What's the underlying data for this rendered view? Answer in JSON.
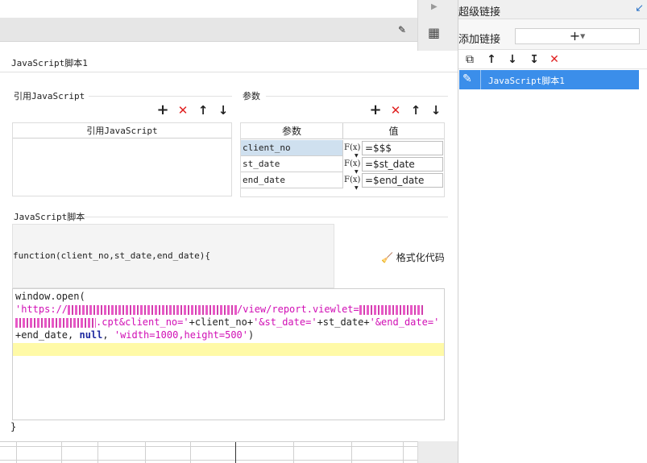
{
  "right_panel": {
    "title": "超级链接",
    "add_label": "添加链接",
    "add_button": "+",
    "icons": [
      "copy-icon",
      "arrow-up-icon",
      "arrow-down-icon",
      "move-bottom-icon",
      "delete-icon"
    ],
    "list": [
      {
        "label": "JavaScript脚本1",
        "selected": true
      }
    ]
  },
  "main": {
    "tab_title": "JavaScript脚本1",
    "ref_section": {
      "title": "引用JavaScript",
      "column": "引用JavaScript"
    },
    "param_section": {
      "title": "参数",
      "columns": [
        "参数",
        "值"
      ],
      "rows": [
        {
          "name": "client_no",
          "fx": "F(x)",
          "value": "=$$$"
        },
        {
          "name": "st_date",
          "fx": "F(x)",
          "value": "=$st_date"
        },
        {
          "name": "end_date",
          "fx": "F(x)",
          "value": "=$end_date"
        }
      ]
    },
    "script_section": {
      "title": "JavaScript脚本",
      "function_signature": "function(client_no,st_date,end_date){",
      "format_button": "格式化代码",
      "code_line1": "window.open(",
      "code_line2_visible": "'https://",
      "code_line2_tail": "/view/report.viewlet=",
      "code_line3_tail": ".cpt&client_no='",
      "code_line3_var1": "+client_no+",
      "code_line3_str2": "'&st_date='",
      "code_line3_var2": "+st_date+",
      "code_line3_str3": "'&end_date='",
      "code_line4_var": "+end_date, ",
      "code_line4_null": "null",
      "code_line4_comma": ", ",
      "code_line4_str": "'width=1000,height=500'",
      "code_line4_close": ")",
      "closing_brace": "}"
    }
  },
  "colors": {
    "accent": "#3b8eea",
    "delete": "#e02020",
    "highlight": "#fffaa7",
    "string": "#d10fb5"
  }
}
